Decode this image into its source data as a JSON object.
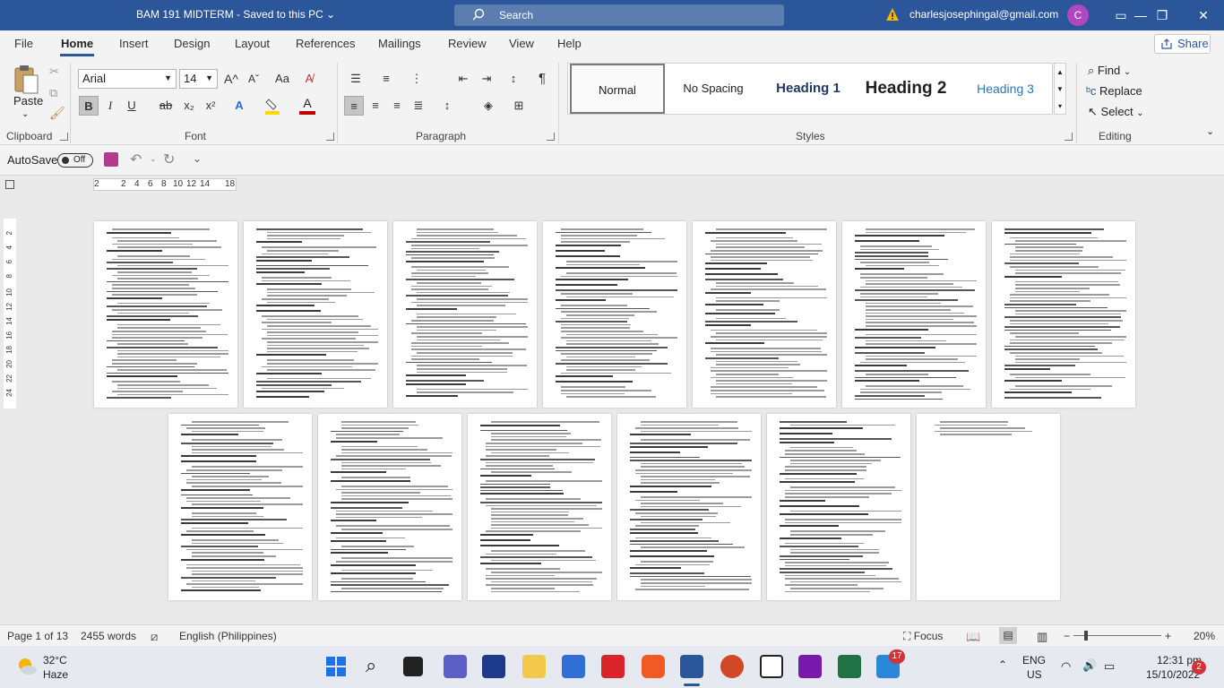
{
  "titlebar": {
    "doc_title": "BAM 191 MIDTERM",
    "save_state": "Saved to this PC",
    "search_label": "Search",
    "email": "charlesjosephingal@gmail.com",
    "avatar_initial": "C",
    "minimize": "—",
    "restore": "❐",
    "close": "✕"
  },
  "menu": {
    "tabs": [
      "File",
      "Home",
      "Insert",
      "Design",
      "Layout",
      "References",
      "Mailings",
      "Review",
      "View",
      "Help"
    ],
    "share": "Share"
  },
  "ribbon": {
    "clipboard": {
      "paste": "Paste",
      "label": "Clipboard"
    },
    "font": {
      "name": "Arial",
      "size": "14",
      "label": "Font",
      "bold": "B",
      "italic": "I",
      "underline": "U",
      "strike": "ab",
      "subscript": "x₂",
      "superscript": "x²",
      "grow": "A^",
      "shrink": "Aˇ",
      "case": "Aa"
    },
    "paragraph": {
      "label": "Paragraph"
    },
    "styles": {
      "label": "Styles",
      "items": [
        "Normal",
        "No Spacing",
        "Heading 1",
        "Heading 2",
        "Heading 3"
      ]
    },
    "editing": {
      "label": "Editing",
      "find": "Find",
      "replace": "Replace",
      "select": "Select"
    }
  },
  "qat": {
    "autosave": "AutoSave",
    "toggle": "Off"
  },
  "ruler": {
    "marks": [
      "2",
      "2",
      "4",
      "6",
      "8",
      "10",
      "12",
      "14",
      "18"
    ]
  },
  "status": {
    "page": "Page 1 of 13",
    "words": "2455 words",
    "language": "English (Philippines)",
    "focus": "Focus",
    "zoom": "20%"
  },
  "taskbar": {
    "temp": "32°C",
    "condition": "Haze",
    "lang_top": "ENG",
    "lang_bottom": "US",
    "time": "12:31 pm",
    "date": "15/10/2022",
    "notification_count": "2",
    "badge_count": "17"
  },
  "colors": {
    "word_blue": "#2b579a",
    "avatar": "#b146c2",
    "font_highlight": "#ffd800",
    "font_color": "#c00000"
  }
}
